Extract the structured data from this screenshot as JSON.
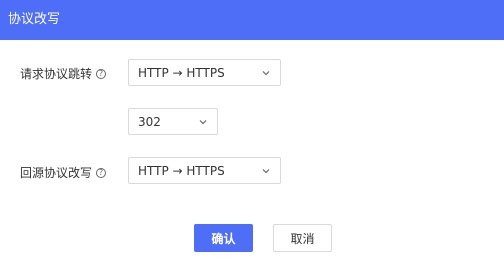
{
  "dialog": {
    "title": "协议改写"
  },
  "form": {
    "redirect": {
      "label": "请求协议跳转",
      "help_icon": "question-circle-icon",
      "selected": "HTTP → HTTPS"
    },
    "status_code": {
      "selected": "302"
    },
    "origin": {
      "label": "回源协议改写",
      "help_icon": "question-circle-icon",
      "selected": "HTTP → HTTPS"
    }
  },
  "actions": {
    "confirm_label": "确认",
    "cancel_label": "取消"
  },
  "colors": {
    "accent": "#4f6ef7",
    "border": "#d9d9d9",
    "text": "#333333"
  }
}
